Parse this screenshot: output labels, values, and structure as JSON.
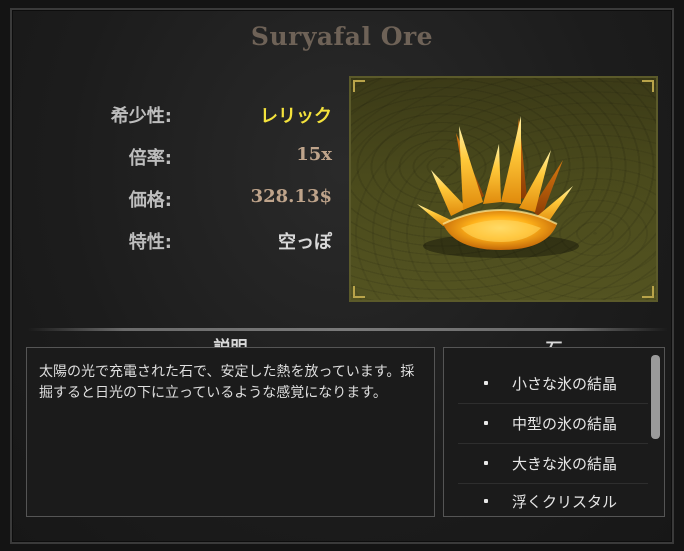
{
  "item": {
    "name": "Suryafal Ore"
  },
  "stats": [
    {
      "label": "希少性:",
      "value": "レリック",
      "color": "#f4e23c"
    },
    {
      "label": "倍率:",
      "value": "15x",
      "color": "#bfa48b"
    },
    {
      "label": "価格:",
      "value": "328.13$",
      "color": "#bfa48b"
    },
    {
      "label": "特性:",
      "value": "空っぽ",
      "color": "#d8d8d8"
    }
  ],
  "description": {
    "heading": "説明",
    "text": "太陽の光で充電された石で、安定した熱を放っています。採掘すると日光の下に立っているような感覚になります。"
  },
  "stones": {
    "heading": "石",
    "items": [
      "小さな氷の結晶",
      "中型の氷の結晶",
      "大きな氷の結晶",
      "浮くクリスタル"
    ]
  },
  "icons": {
    "item_image": "flame-crystal-icon",
    "bullet": "bullet-icon"
  }
}
